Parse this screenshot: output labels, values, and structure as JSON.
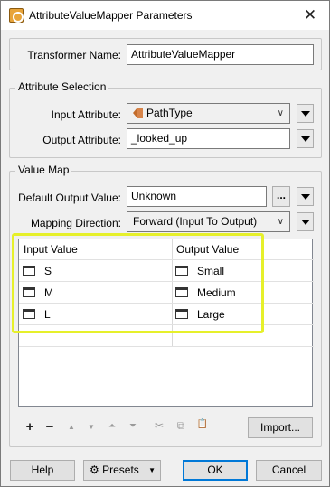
{
  "window": {
    "title": "AttributeValueMapper Parameters",
    "close_glyph": "✕"
  },
  "transformer": {
    "label": "Transformer Name:",
    "value": "AttributeValueMapper"
  },
  "attribute_selection": {
    "title": "Attribute Selection",
    "input_label": "Input Attribute:",
    "input_value": "PathType",
    "input_icon": "attribute-tag-icon",
    "output_label": "Output Attribute:",
    "output_value": "_looked_up"
  },
  "value_map": {
    "title": "Value Map",
    "default_label": "Default Output Value:",
    "default_value": "Unknown",
    "direction_label": "Mapping Direction:",
    "direction_value": "Forward (Input To Output)",
    "columns": [
      "Input Value",
      "Output Value"
    ],
    "rows": [
      {
        "input": "S",
        "output": "Small"
      },
      {
        "input": "M",
        "output": "Medium"
      },
      {
        "input": "L",
        "output": "Large"
      }
    ],
    "highlight_color": "#e6f02a"
  },
  "toolbar": {
    "add": "+",
    "remove": "−",
    "move_up": "▲",
    "move_down": "▼",
    "move_top": "⏶",
    "move_bottom": "⏷",
    "cut": "✂",
    "copy": "⧉",
    "paste": "📋",
    "import_label": "Import..."
  },
  "footer": {
    "help_label": "Help",
    "presets_label": "Presets",
    "ok_label": "OK",
    "cancel_label": "Cancel"
  },
  "colors": {
    "accent": "#0078d7",
    "window_bg": "#f0f0f0"
  }
}
